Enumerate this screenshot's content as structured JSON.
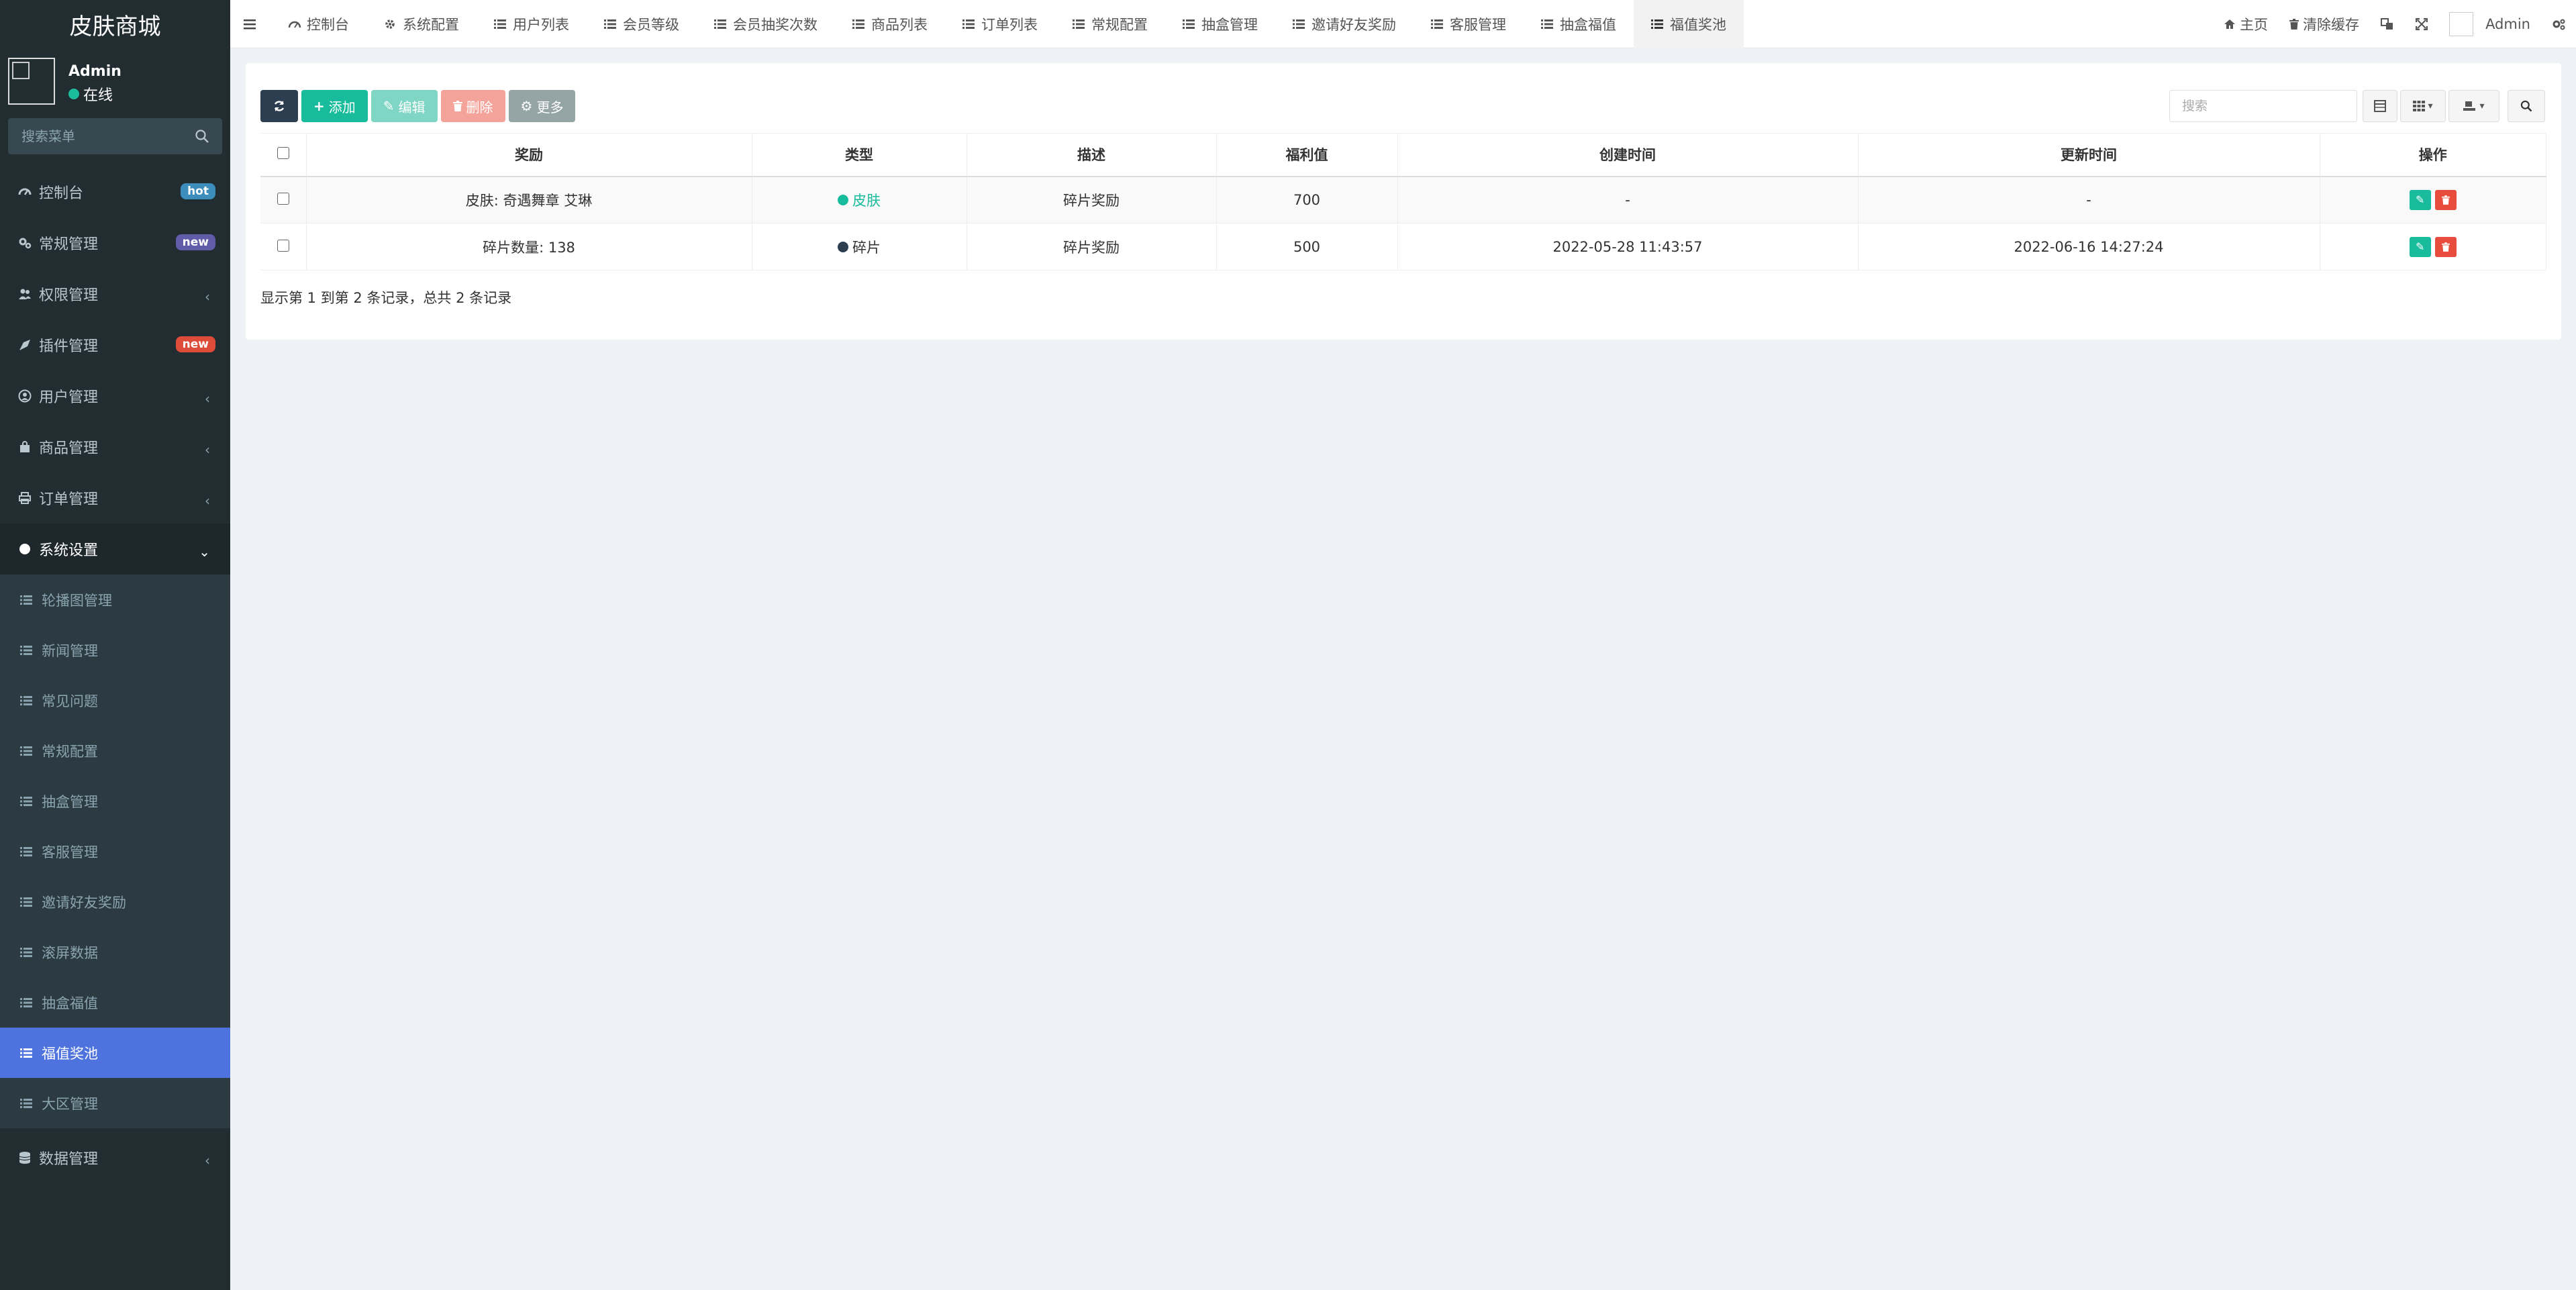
{
  "app": {
    "title": "皮肤商城"
  },
  "user": {
    "name": "Admin",
    "status": "在线"
  },
  "sidebar": {
    "search_placeholder": "搜索菜单",
    "items": [
      {
        "label": "控制台",
        "icon": "dashboard-icon",
        "badge": "hot",
        "badge_color": "#3c8dbc"
      },
      {
        "label": "常规管理",
        "icon": "gears-icon",
        "badge": "new",
        "badge_color": "#605ca8"
      },
      {
        "label": "权限管理",
        "icon": "group-icon"
      },
      {
        "label": "插件管理",
        "icon": "rocket-icon",
        "badge": "new",
        "badge_color": "#dd4b39"
      },
      {
        "label": "用户管理",
        "icon": "user-circle-icon"
      },
      {
        "label": "商品管理",
        "icon": "shopping-bag-icon"
      },
      {
        "label": "订单管理",
        "icon": "print-icon"
      },
      {
        "label": "系统设置",
        "icon": "circle-icon"
      }
    ],
    "subitems": [
      {
        "label": "轮播图管理"
      },
      {
        "label": "新闻管理"
      },
      {
        "label": "常见问题"
      },
      {
        "label": "常规配置"
      },
      {
        "label": "抽盒管理"
      },
      {
        "label": "客服管理"
      },
      {
        "label": "邀请好友奖励"
      },
      {
        "label": "滚屏数据"
      },
      {
        "label": "抽盒福值"
      },
      {
        "label": "福值奖池"
      },
      {
        "label": "大区管理"
      }
    ],
    "last_item": {
      "label": "数据管理",
      "icon": "database-icon"
    }
  },
  "topnav": {
    "tabs": [
      {
        "label": "控制台",
        "icon": "dashboard-icon"
      },
      {
        "label": "系统配置",
        "icon": "gear-icon"
      },
      {
        "label": "用户列表",
        "icon": "list-icon"
      },
      {
        "label": "会员等级",
        "icon": "list-icon"
      },
      {
        "label": "会员抽奖次数",
        "icon": "list-icon"
      },
      {
        "label": "商品列表",
        "icon": "list-icon"
      },
      {
        "label": "订单列表",
        "icon": "list-icon"
      },
      {
        "label": "常规配置",
        "icon": "list-icon"
      },
      {
        "label": "抽盒管理",
        "icon": "list-icon"
      },
      {
        "label": "邀请好友奖励",
        "icon": "list-icon"
      },
      {
        "label": "客服管理",
        "icon": "list-icon"
      },
      {
        "label": "抽盒福值",
        "icon": "list-icon"
      },
      {
        "label": "福值奖池",
        "icon": "list-icon"
      }
    ],
    "home_label": "主页",
    "clear_cache_label": "清除缓存",
    "admin_label": "Admin"
  },
  "toolbar": {
    "add_label": "添加",
    "edit_label": "编辑",
    "delete_label": "删除",
    "more_label": "更多",
    "search_placeholder": "搜索"
  },
  "table": {
    "columns": [
      "奖励",
      "类型",
      "描述",
      "福利值",
      "创建时间",
      "更新时间",
      "操作"
    ],
    "rows": [
      {
        "reward": "皮肤: 奇遇舞章 艾琳",
        "type": "皮肤",
        "type_color": "#18bc9c",
        "desc": "碎片奖励",
        "value": "700",
        "created": "-",
        "updated": "-"
      },
      {
        "reward": "碎片数量: 138",
        "type": "碎片",
        "type_color": "#2c3e50",
        "desc": "碎片奖励",
        "value": "500",
        "created": "2022-05-28 11:43:57",
        "updated": "2022-06-16 14:27:24"
      }
    ]
  },
  "pagination": {
    "info": "显示第 1 到第 2 条记录，总共 2 条记录"
  }
}
